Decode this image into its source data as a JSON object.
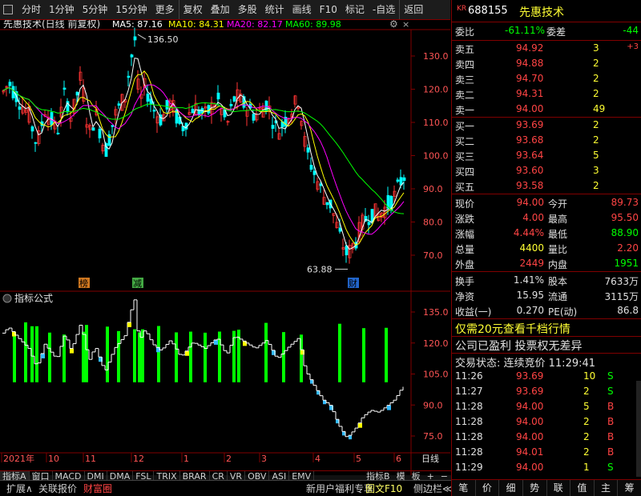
{
  "toolbar": {
    "items": [
      "分时",
      "1分钟",
      "5分钟",
      "15分钟",
      "更多",
      "复权",
      "叠加",
      "多股",
      "统计",
      "画线",
      "F10",
      "标记",
      "-自选",
      "返回"
    ]
  },
  "main": {
    "title": "先惠技术(日线 前复权)",
    "ma5": "MA5: 87.16",
    "ma10": "MA10: 84.31",
    "ma20": "MA20: 82.17",
    "ma60": "MA60: 89.98",
    "yticks": [
      "130.0",
      "120.0",
      "110.0",
      "100.0",
      "90.0",
      "80.0",
      "70.0"
    ],
    "hi_label": "136.50",
    "lo_label": "63.88",
    "marker_bang": "榜",
    "marker_jian": "减",
    "marker_cai": "财"
  },
  "indicator": {
    "title": "指标公式",
    "yticks": [
      "135.0",
      "120.0",
      "105.0",
      "90.0",
      "75.0"
    ]
  },
  "xaxis": {
    "labels": [
      "2021年",
      "10",
      "11",
      "12",
      "1",
      "2",
      "3",
      "4",
      "5",
      "6"
    ],
    "period": "日线"
  },
  "colors": {
    "ma5": "#ffffff",
    "ma10": "#ffff00",
    "ma20": "#ff00ff",
    "ma60": "#00ff00",
    "up": "#ff3333",
    "down": "#00ffff",
    "grid": "#800000",
    "bar": "#00ff00"
  },
  "tabs": {
    "items": [
      "指标A",
      "窗口",
      "MACD",
      "DMI",
      "DMA",
      "FSL",
      "TRIX",
      "BRAR",
      "CR",
      "VR",
      "OBV",
      "ASI",
      "EMV"
    ],
    "right": [
      "指标B",
      "模",
      "板",
      "+",
      "−"
    ]
  },
  "bottombar": {
    "left": [
      "扩展∧",
      "关联报价",
      "财富圈"
    ],
    "right": [
      "新用户福利专享",
      "图文F10",
      "侧边栏≪"
    ]
  },
  "quote": {
    "code": "688155",
    "name": "先惠技术",
    "ratio_label": "委比",
    "ratio": "-61.11%",
    "diff_label": "委差",
    "diff": "-44",
    "asks": [
      {
        "label": "卖五",
        "price": "94.92",
        "vol": "3",
        "chg": "+3"
      },
      {
        "label": "卖四",
        "price": "94.88",
        "vol": "2",
        "chg": ""
      },
      {
        "label": "卖三",
        "price": "94.70",
        "vol": "2",
        "chg": ""
      },
      {
        "label": "卖二",
        "price": "94.31",
        "vol": "2",
        "chg": ""
      },
      {
        "label": "卖一",
        "price": "94.00",
        "vol": "49",
        "chg": ""
      }
    ],
    "bids": [
      {
        "label": "买一",
        "price": "93.69",
        "vol": "2"
      },
      {
        "label": "买二",
        "price": "93.68",
        "vol": "2"
      },
      {
        "label": "买三",
        "price": "93.64",
        "vol": "5"
      },
      {
        "label": "买四",
        "price": "93.60",
        "vol": "3"
      },
      {
        "label": "买五",
        "price": "93.58",
        "vol": "2"
      }
    ],
    "stats": [
      [
        "现价",
        "94.00",
        "今开",
        "89.73"
      ],
      [
        "涨跌",
        "4.00",
        "最高",
        "95.50"
      ],
      [
        "涨幅",
        "4.44%",
        "最低",
        "88.90"
      ],
      [
        "总量",
        "4400",
        "量比",
        "2.20"
      ],
      [
        "外盘",
        "2449",
        "内盘",
        "1951"
      ]
    ],
    "stats2": [
      [
        "换手",
        "1.41%",
        "股本",
        "7633万"
      ],
      [
        "净资",
        "15.95",
        "流通",
        "3115万"
      ],
      [
        "收益(一)",
        "0.270",
        "PE(动)",
        "86.8"
      ]
    ],
    "promo": "仅需20元查看千档行情",
    "notice": "公司已盈利 投票权无差异",
    "status": "交易状态: 连续竞价 11:29:41",
    "ticks": [
      [
        "11:26",
        "93.69",
        "10",
        "S"
      ],
      [
        "11:27",
        "93.69",
        "2",
        "S"
      ],
      [
        "11:28",
        "94.00",
        "5",
        "B"
      ],
      [
        "11:28",
        "94.00",
        "2",
        "B"
      ],
      [
        "11:28",
        "94.00",
        "2",
        "B"
      ],
      [
        "11:28",
        "94.01",
        "2",
        "B"
      ],
      [
        "11:29",
        "94.00",
        "1",
        "S"
      ]
    ]
  },
  "bottom_tools": [
    "笔",
    "价",
    "细",
    "势",
    "联",
    "值",
    "主",
    "筹"
  ]
}
